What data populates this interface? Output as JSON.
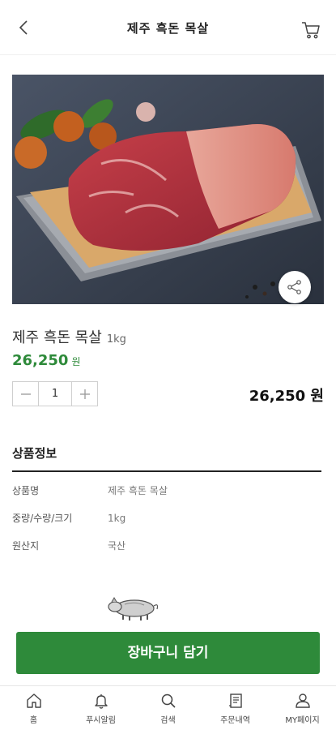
{
  "header": {
    "title": "제주 흑돈 목살",
    "back_icon": "chevron-left-icon",
    "cart_icon": "cart-icon"
  },
  "product": {
    "name": "제주 흑돈 목살",
    "unit": "1kg",
    "price": "26,250",
    "price_unit": "원",
    "quantity": "1",
    "total": "26,250 원"
  },
  "info": {
    "title": "상품정보",
    "rows": [
      {
        "label": "상품명",
        "value": "제주 흑돈 목살"
      },
      {
        "label": "중량/수량/크기",
        "value": "1kg"
      },
      {
        "label": "원산지",
        "value": "국산"
      }
    ]
  },
  "cart_button": {
    "label": "장바구니 담기"
  },
  "tabbar": [
    {
      "label": "홈",
      "icon": "home-icon"
    },
    {
      "label": "푸시알림",
      "icon": "bell-icon"
    },
    {
      "label": "검색",
      "icon": "search-icon"
    },
    {
      "label": "주문내역",
      "icon": "receipt-icon"
    },
    {
      "label": "MY페이지",
      "icon": "user-icon"
    }
  ],
  "colors": {
    "accent": "#2e8a3a",
    "text": "#333333"
  }
}
